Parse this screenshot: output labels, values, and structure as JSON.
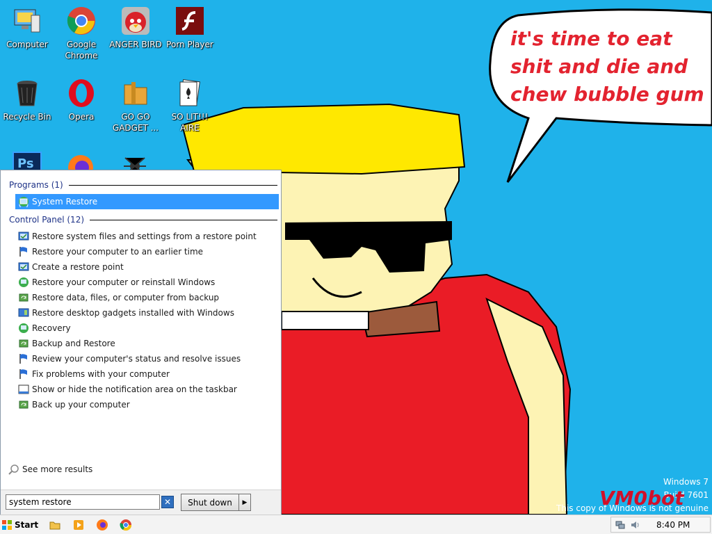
{
  "desktop": {
    "icons": [
      {
        "label": "Computer",
        "icon": "computer-icon"
      },
      {
        "label": "Google Chrome",
        "icon": "chrome-icon"
      },
      {
        "label": "ANGER BIRD",
        "icon": "angry-bird-icon"
      },
      {
        "label": "Porn Player",
        "icon": "flash-icon"
      },
      {
        "label": "Recycle Bin",
        "icon": "recycle-bin-icon"
      },
      {
        "label": "Opera",
        "icon": "opera-icon"
      },
      {
        "label": "GO GO GADGET ...",
        "icon": "folder-icon"
      },
      {
        "label": "SO LIT!!! AIRE",
        "icon": "cards-icon"
      }
    ],
    "speech_bubble": "it's time to eat shit and die and chew bubble gum",
    "watermark": {
      "line1": "Windows 7",
      "line2": "Build 7601",
      "line3": "This copy of Windows is not genuine",
      "tag": "VM0bot"
    }
  },
  "start_menu": {
    "programs_header": "Programs (1)",
    "programs": [
      {
        "label": "System Restore",
        "icon": "system-restore-icon",
        "selected": true
      }
    ],
    "control_panel_header": "Control Panel (12)",
    "control_panel": [
      {
        "label": "Restore system files and settings from a restore point",
        "icon": "system-window-icon"
      },
      {
        "label": "Restore your computer to an earlier time",
        "icon": "flag-icon"
      },
      {
        "label": "Create a restore point",
        "icon": "system-window-icon"
      },
      {
        "label": "Restore your computer or reinstall Windows",
        "icon": "recovery-icon"
      },
      {
        "label": "Restore data, files, or computer from backup",
        "icon": "backup-icon"
      },
      {
        "label": "Restore desktop gadgets installed with Windows",
        "icon": "gadgets-icon"
      },
      {
        "label": "Recovery",
        "icon": "recovery-icon"
      },
      {
        "label": "Backup and Restore",
        "icon": "backup-icon"
      },
      {
        "label": "Review your computer's status and resolve issues",
        "icon": "flag-icon"
      },
      {
        "label": "Fix problems with your computer",
        "icon": "flag-icon"
      },
      {
        "label": "Show or hide the notification area on the taskbar",
        "icon": "taskbar-icon"
      },
      {
        "label": "Back up your computer",
        "icon": "backup-icon"
      }
    ],
    "see_more": "See more results",
    "search_value": "system restore",
    "shutdown_label": "Shut down"
  },
  "taskbar": {
    "start_label": "Start",
    "pinned": [
      "explorer-icon",
      "media-player-icon",
      "firefox-icon",
      "chrome-icon"
    ],
    "clock": "8:40 PM"
  },
  "colors": {
    "desktop_bg": "#1fb2ea",
    "selection": "#3399ff",
    "header_text": "#1e3287",
    "bubble_text": "#e3232f"
  }
}
